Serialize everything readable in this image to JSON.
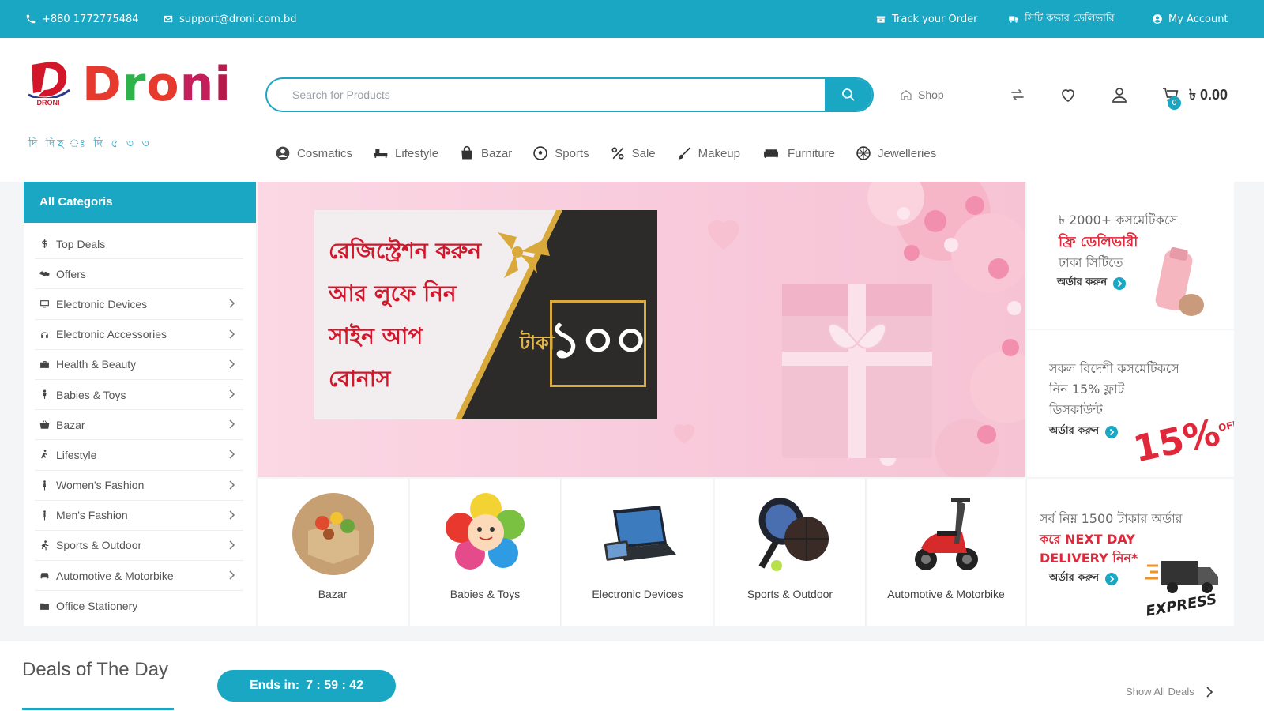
{
  "topbar": {
    "phone": "+880 1772775484",
    "email": "support@droni.com.bd",
    "track_order": "Track your Order",
    "bangla_link": "সিটি কভার ডেলিভারি",
    "my_account": "My Account"
  },
  "header": {
    "logo_text": "Droni",
    "logo_mark_text": "DRONI",
    "logo_tagline": "দি দিছ  ঃ     দি ৫ ৩ ৩",
    "search_placeholder": "Search for Products",
    "shop_label": "Shop",
    "cart_count": "0",
    "cart_total": "৳ 0.00"
  },
  "category_nav": [
    {
      "label": "Cosmatics",
      "icon": "user-circle-icon"
    },
    {
      "label": "Lifestyle",
      "icon": "lounge-chair-icon"
    },
    {
      "label": "Bazar",
      "icon": "shopping-bag-icon"
    },
    {
      "label": "Sports",
      "icon": "soccer-ball-icon"
    },
    {
      "label": "Sale",
      "icon": "percent-icon"
    },
    {
      "label": "Makeup",
      "icon": "brush-icon"
    },
    {
      "label": "Furniture",
      "icon": "sofa-icon"
    },
    {
      "label": "Jewelleries",
      "icon": "gem-icon"
    }
  ],
  "sidebar": {
    "title": "All Categoris",
    "items": [
      {
        "label": "Top Deals",
        "icon": "dollar-icon",
        "chevron": false
      },
      {
        "label": "Offers",
        "icon": "handshake-icon",
        "chevron": false
      },
      {
        "label": "Electronic Devices",
        "icon": "monitor-icon",
        "chevron": true
      },
      {
        "label": "Electronic Accessories",
        "icon": "headphones-icon",
        "chevron": true
      },
      {
        "label": "Health & Beauty",
        "icon": "briefcase-icon",
        "chevron": true
      },
      {
        "label": "Babies & Toys",
        "icon": "baby-icon",
        "chevron": true
      },
      {
        "label": "Bazar",
        "icon": "basket-icon",
        "chevron": true
      },
      {
        "label": "Lifestyle",
        "icon": "lifestyle-icon",
        "chevron": true
      },
      {
        "label": "Women's Fashion",
        "icon": "woman-icon",
        "chevron": true
      },
      {
        "label": "Men's Fashion",
        "icon": "man-icon",
        "chevron": true
      },
      {
        "label": "Sports & Outdoor",
        "icon": "running-icon",
        "chevron": true
      },
      {
        "label": "Automotive & Motorbike",
        "icon": "car-icon",
        "chevron": true
      },
      {
        "label": "Office Stationery",
        "icon": "folder-icon",
        "chevron": false
      }
    ]
  },
  "banner": {
    "line1": "রেজিস্ট্রেশন করুন",
    "line2": "আর লুফে নিন",
    "line3": "সাইন আপ",
    "line4": "বোনাস",
    "currency": "টাকা",
    "amount": "১০০"
  },
  "right_promos": [
    {
      "lines": [
        "৳ 2000+ কসমেটিকসে",
        "ফ্রি ডেলিভারী",
        "ঢাকা সিটিতে"
      ],
      "cta": "অর্ডার করুন"
    },
    {
      "lines": [
        "সকল বিদেশী কসমেটিকসে",
        "নিন 15% ফ্লাট",
        "ডিসকাউন্ট"
      ],
      "cta": "অর্ডার করুন",
      "badge": "15%",
      "badge_sub": "OFF"
    },
    {
      "lines": [
        "সর্ব নিম্ন 1500 টাকার অর্ডার",
        "করে NEXT DAY",
        "DELIVERY নিন*"
      ],
      "cta": "অর্ডার করুন",
      "badge": "EXPRESS"
    }
  ],
  "tiles": [
    {
      "label": "Bazar"
    },
    {
      "label": "Babies & Toys"
    },
    {
      "label": "Electronic Devices"
    },
    {
      "label": "Sports & Outdoor"
    },
    {
      "label": "Automotive & Motorbike"
    }
  ],
  "deals": {
    "title": "Deals of The Day",
    "timer_label": "Ends in:",
    "timer_value": "7 : 59 : 42",
    "show_all": "Show All Deals"
  },
  "colors": {
    "accent": "#19a7c4",
    "red": "#d3172b",
    "gold": "#d9a93b"
  }
}
